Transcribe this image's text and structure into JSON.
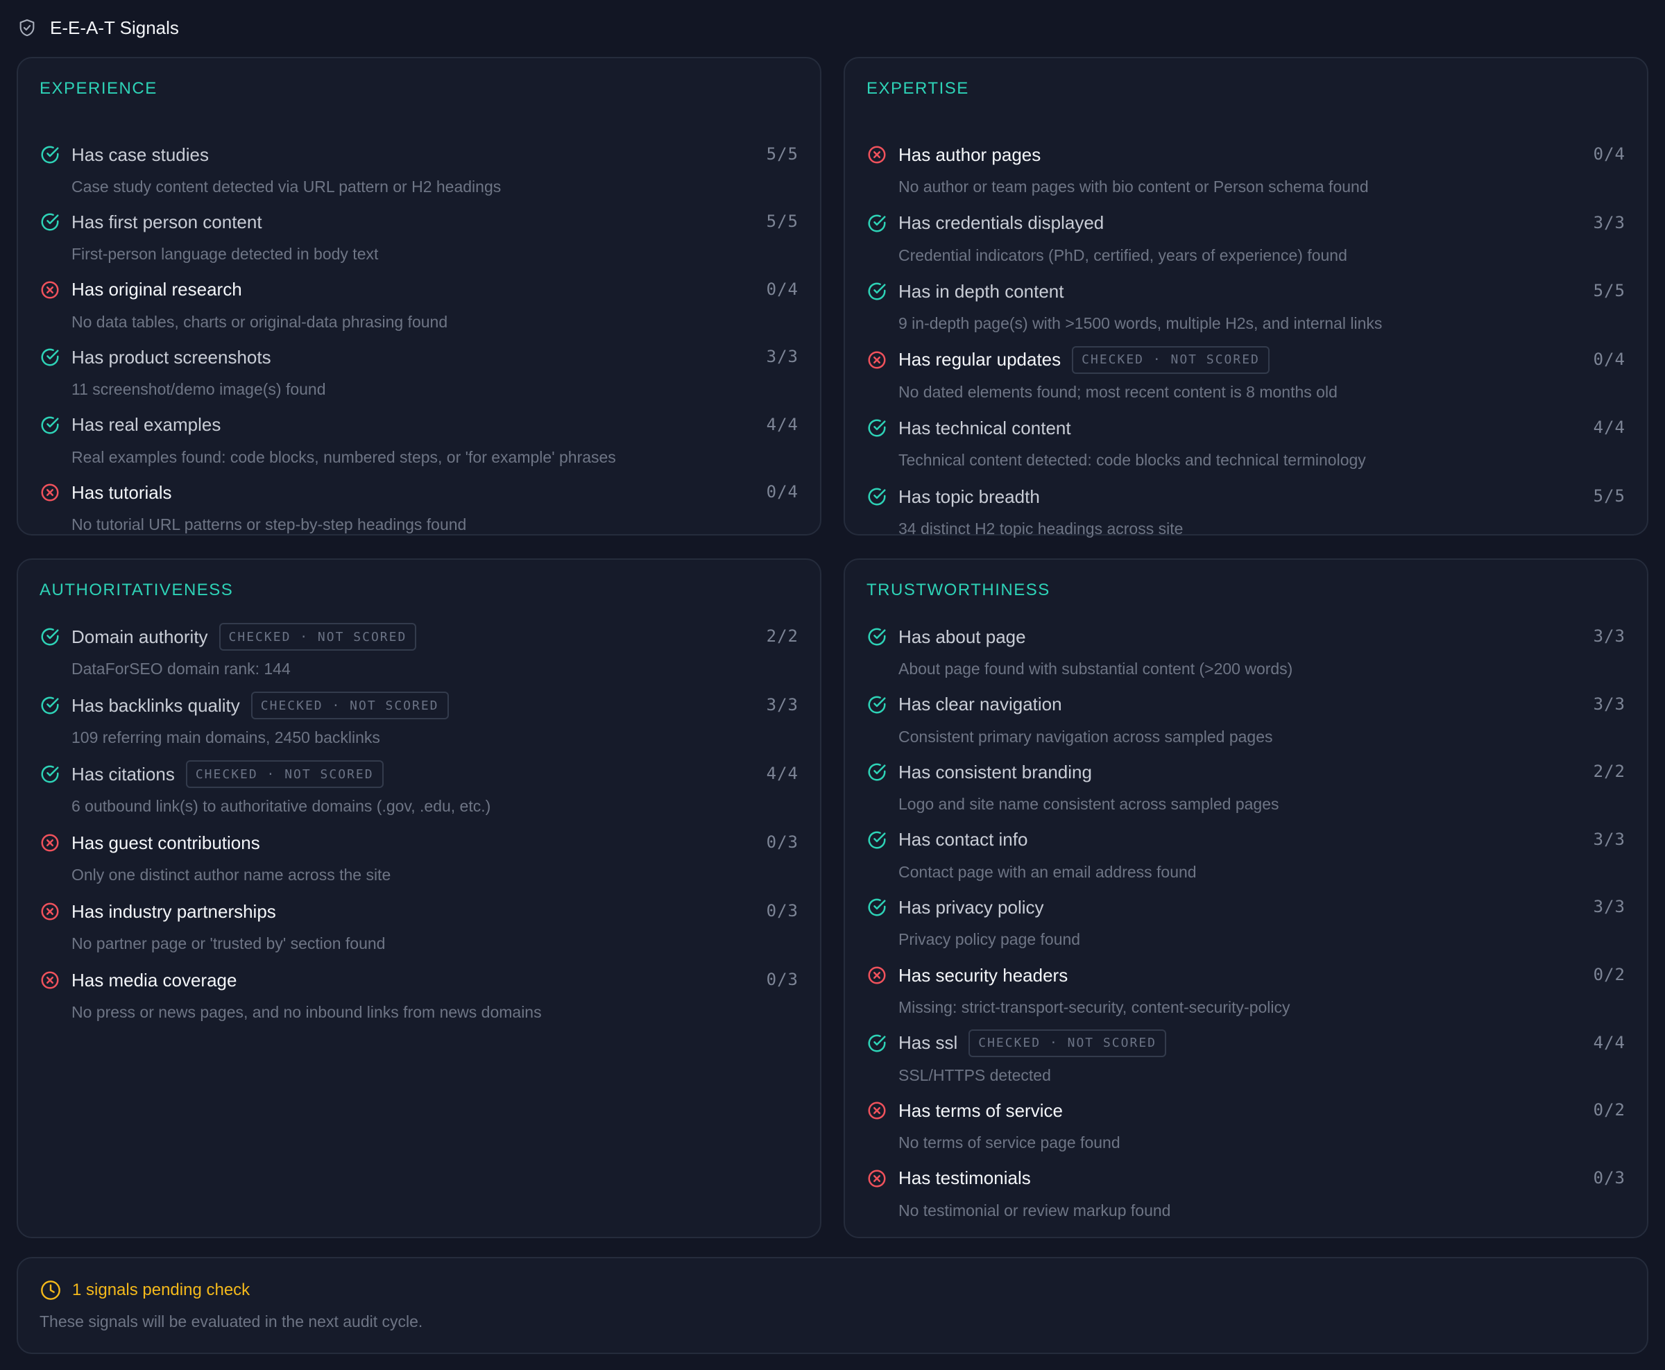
{
  "header": {
    "title": "E-E-A-T Signals",
    "icon": "shield-check-icon"
  },
  "colors": {
    "pass": "#2ed3b7",
    "fail": "#f0525c",
    "accent": "#2ed3b7",
    "pending": "#f4b91b"
  },
  "badge_label": "CHECKED · NOT SCORED",
  "categories": [
    {
      "name": "EXPERIENCE",
      "signals": [
        {
          "label": "Has case studies",
          "status": "pass",
          "score": "5/5",
          "desc": "Case study content detected via URL pattern or H2 headings",
          "badge": false
        },
        {
          "label": "Has first person content",
          "status": "pass",
          "score": "5/5",
          "desc": "First-person language detected in body text",
          "badge": false
        },
        {
          "label": "Has original research",
          "status": "fail",
          "score": "0/4",
          "desc": "No data tables, charts or original-data phrasing found",
          "badge": false
        },
        {
          "label": "Has product screenshots",
          "status": "pass",
          "score": "3/3",
          "desc": "11 screenshot/demo image(s) found",
          "badge": false
        },
        {
          "label": "Has real examples",
          "status": "pass",
          "score": "4/4",
          "desc": "Real examples found: code blocks, numbered steps, or 'for example' phrases",
          "badge": false
        },
        {
          "label": "Has tutorials",
          "status": "fail",
          "score": "0/4",
          "desc": "No tutorial URL patterns or step-by-step headings found",
          "badge": false
        }
      ]
    },
    {
      "name": "EXPERTISE",
      "signals": [
        {
          "label": "Has author pages",
          "status": "fail",
          "score": "0/4",
          "desc": "No author or team pages with bio content or Person schema found",
          "badge": false
        },
        {
          "label": "Has credentials displayed",
          "status": "pass",
          "score": "3/3",
          "desc": "Credential indicators (PhD, certified, years of experience) found",
          "badge": false
        },
        {
          "label": "Has in depth content",
          "status": "pass",
          "score": "5/5",
          "desc": "9 in-depth page(s) with >1500 words, multiple H2s, and internal links",
          "badge": false
        },
        {
          "label": "Has regular updates",
          "status": "fail",
          "score": "0/4",
          "desc": "No dated elements found; most recent content is 8 months old",
          "badge": true
        },
        {
          "label": "Has technical content",
          "status": "pass",
          "score": "4/4",
          "desc": "Technical content detected: code blocks and technical terminology",
          "badge": false
        },
        {
          "label": "Has topic breadth",
          "status": "pass",
          "score": "5/5",
          "desc": "34 distinct H2 topic headings across site",
          "badge": false
        }
      ]
    },
    {
      "name": "AUTHORITATIVENESS",
      "signals": [
        {
          "label": "Domain authority",
          "status": "pass",
          "score": "2/2",
          "desc": "DataForSEO domain rank: 144",
          "badge": true
        },
        {
          "label": "Has backlinks quality",
          "status": "pass",
          "score": "3/3",
          "desc": "109 referring main domains, 2450 backlinks",
          "badge": true
        },
        {
          "label": "Has citations",
          "status": "pass",
          "score": "4/4",
          "desc": "6 outbound link(s) to authoritative domains (.gov, .edu, etc.)",
          "badge": true
        },
        {
          "label": "Has guest contributions",
          "status": "fail",
          "score": "0/3",
          "desc": "Only one distinct author name across the site",
          "badge": false
        },
        {
          "label": "Has industry partnerships",
          "status": "fail",
          "score": "0/3",
          "desc": "No partner page or 'trusted by' section found",
          "badge": false
        },
        {
          "label": "Has media coverage",
          "status": "fail",
          "score": "0/3",
          "desc": "No press or news pages, and no inbound links from news domains",
          "badge": false
        }
      ]
    },
    {
      "name": "TRUSTWORTHINESS",
      "signals": [
        {
          "label": "Has about page",
          "status": "pass",
          "score": "3/3",
          "desc": "About page found with substantial content (>200 words)",
          "badge": false
        },
        {
          "label": "Has clear navigation",
          "status": "pass",
          "score": "3/3",
          "desc": "Consistent primary navigation across sampled pages",
          "badge": false
        },
        {
          "label": "Has consistent branding",
          "status": "pass",
          "score": "2/2",
          "desc": "Logo and site name consistent across sampled pages",
          "badge": false
        },
        {
          "label": "Has contact info",
          "status": "pass",
          "score": "3/3",
          "desc": "Contact page with an email address found",
          "badge": false
        },
        {
          "label": "Has privacy policy",
          "status": "pass",
          "score": "3/3",
          "desc": "Privacy policy page found",
          "badge": false
        },
        {
          "label": "Has security headers",
          "status": "fail",
          "score": "0/2",
          "desc": "Missing: strict-transport-security, content-security-policy",
          "badge": false
        },
        {
          "label": "Has ssl",
          "status": "pass",
          "score": "4/4",
          "desc": "SSL/HTTPS detected",
          "badge": true
        },
        {
          "label": "Has terms of service",
          "status": "fail",
          "score": "0/2",
          "desc": "No terms of service page found",
          "badge": false
        },
        {
          "label": "Has testimonials",
          "status": "fail",
          "score": "0/3",
          "desc": "No testimonial or review markup found",
          "badge": false
        }
      ]
    }
  ],
  "pending": {
    "icon": "clock-icon",
    "title": "1 signals pending check",
    "desc": "These signals will be evaluated in the next audit cycle."
  }
}
